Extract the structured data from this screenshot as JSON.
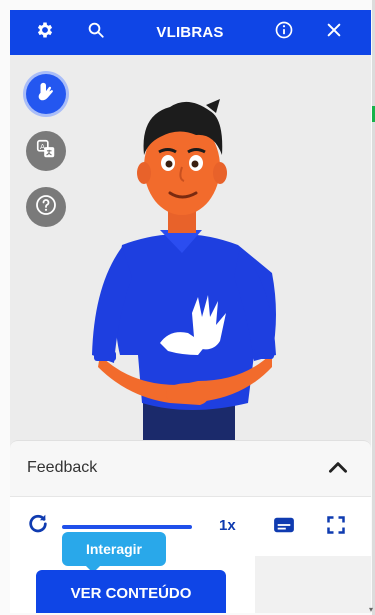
{
  "header": {
    "title": "VLIBRAS",
    "settings_icon": "gear-icon",
    "search_icon": "search-icon",
    "info_icon": "info-icon",
    "close_icon": "close-icon"
  },
  "sidebar": {
    "items": [
      {
        "name": "hand-icon",
        "state": "active"
      },
      {
        "name": "translate-icon",
        "state": "inactive"
      },
      {
        "name": "help-icon",
        "state": "inactive"
      }
    ]
  },
  "avatar": {
    "description_icon": "avatar-3d",
    "shirt_color": "#1e3fe0",
    "skin_color": "#f26b2c"
  },
  "feedback": {
    "label": "Feedback",
    "chevron_icon": "chevron-up-icon"
  },
  "controls": {
    "replay_icon": "replay-icon",
    "speed_label": "1x",
    "subtitles_icon": "subtitles-icon",
    "fullscreen_icon": "fullscreen-icon"
  },
  "tooltip": {
    "label": "Interagir"
  },
  "cta": {
    "label": "VER CONTEÚDO"
  },
  "colors": {
    "brand": "#0f45e6",
    "tooltip": "#29a8ea",
    "accent_green": "#17b34a"
  }
}
